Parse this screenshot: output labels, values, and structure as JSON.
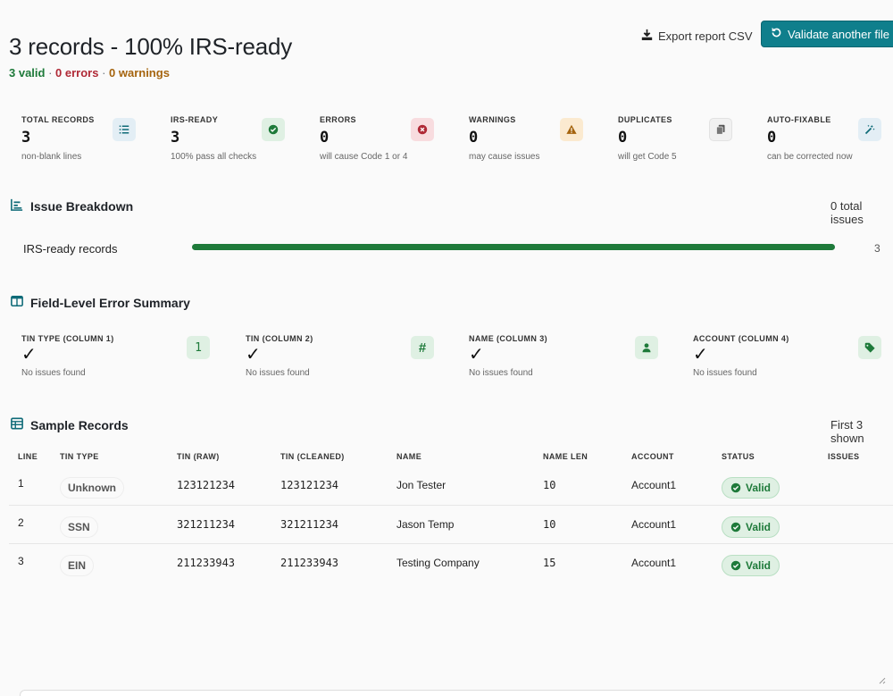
{
  "header": {
    "title": "3 records - 100% IRS-ready",
    "summary": {
      "valid": "3 valid",
      "errors": "0 errors",
      "warnings": "0 warnings",
      "separator": " · "
    },
    "export_label": "Export report CSV",
    "validate_label": "Validate another file"
  },
  "stats": [
    {
      "label": "Total Records",
      "value": "3",
      "sub": "non-blank lines",
      "icon": "list-icon",
      "icon_bg": "#e3eef5",
      "icon_color": "#0f6b78"
    },
    {
      "label": "IRS-Ready",
      "value": "3",
      "sub": "100% pass all checks",
      "icon": "check-circle-icon",
      "icon_bg": "#dff0e3",
      "icon_color": "#1e7a3a"
    },
    {
      "label": "Errors",
      "value": "0",
      "sub": "will cause Code 1 or 4",
      "icon": "x-circle-icon",
      "icon_bg": "#f8dcdf",
      "icon_color": "#b02a37"
    },
    {
      "label": "Warnings",
      "value": "0",
      "sub": "may cause issues",
      "icon": "warning-icon",
      "icon_bg": "#fbead0",
      "icon_color": "#a5640e"
    },
    {
      "label": "Duplicates",
      "value": "0",
      "sub": "will get Code 5",
      "icon": "copy-icon",
      "icon_bg": "#f1f1f1",
      "icon_color": "#555555"
    },
    {
      "label": "Auto-Fixable",
      "value": "0",
      "sub": "can be corrected now",
      "icon": "magic-wand-icon",
      "icon_bg": "#e3eef5",
      "icon_color": "#0f6b78"
    }
  ],
  "breakdown": {
    "title": "Issue Breakdown",
    "total": "0 total issues",
    "rows": [
      {
        "label": "IRS-ready records",
        "count": "3",
        "fraction": 1.0
      }
    ]
  },
  "field_summary": {
    "title": "Field-Level Error Summary",
    "fields": [
      {
        "label": "TIN Type (column 1)",
        "check": "✓",
        "sub": "No issues found",
        "icon": "number-one-icon",
        "glyph": "1"
      },
      {
        "label": "TIN (column 2)",
        "check": "✓",
        "sub": "No issues found",
        "icon": "hash-icon",
        "glyph": "#"
      },
      {
        "label": "Name (column 3)",
        "check": "✓",
        "sub": "No issues found",
        "icon": "person-icon",
        "glyph": ""
      },
      {
        "label": "Account (column 4)",
        "check": "✓",
        "sub": "No issues found",
        "icon": "tag-icon",
        "glyph": ""
      }
    ]
  },
  "samples": {
    "title": "Sample Records",
    "note": "First 3 shown",
    "columns": [
      "Line",
      "TIN Type",
      "TIN (raw)",
      "TIN (cleaned)",
      "Name",
      "Name Len",
      "Account",
      "Status",
      "Issues"
    ],
    "rows": [
      {
        "line": "1",
        "tin_type": "Unknown",
        "tin_raw": "123121234",
        "tin_clean": "123121234",
        "name": "Jon Tester",
        "name_len": "10",
        "account": "Account1",
        "status": "Valid",
        "issues": ""
      },
      {
        "line": "2",
        "tin_type": "SSN",
        "tin_raw": "321211234",
        "tin_clean": "321211234",
        "name": "Jason Temp",
        "name_len": "10",
        "account": "Account1",
        "status": "Valid",
        "issues": ""
      },
      {
        "line": "3",
        "tin_type": "EIN",
        "tin_raw": "211233943",
        "tin_clean": "211233943",
        "name": "Testing Company",
        "name_len": "15",
        "account": "Account1",
        "status": "Valid",
        "issues": ""
      }
    ]
  }
}
